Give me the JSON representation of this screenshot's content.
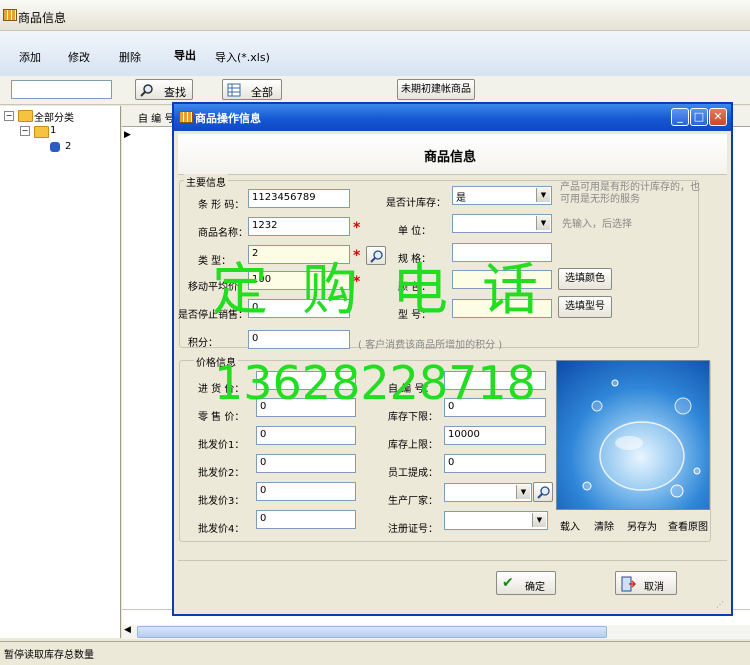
{
  "window": {
    "title": "商品信息"
  },
  "toolbar": {
    "add": "添加",
    "edit": "修改",
    "delete": "删除",
    "export": "导出",
    "import": "导入(*.xls)"
  },
  "search": {
    "value": "",
    "find": "查找",
    "all": "全部",
    "opening": "未期初建帐商品"
  },
  "tree": {
    "root": "全部分类",
    "child1": "1",
    "child2": "2"
  },
  "grid": {
    "col_code": "自 编 号"
  },
  "status": {
    "text": "暂停读取库存总数量"
  },
  "dialog": {
    "title": "商品操作信息",
    "heading": "商品信息",
    "main_group": "主要信息",
    "price_group": "价格信息",
    "fields": {
      "barcode_label": "条 形 码：",
      "barcode": "1123456789",
      "name_label": "商品名称：",
      "name": "1232",
      "category_label": "类     型：",
      "category": "2",
      "move_avg_label": "移动平均价",
      "move_avg": "100",
      "discontinued_label": "是否停止销售：",
      "discontinued": "0",
      "points_label": "积分：",
      "points": "0",
      "points_hint": "( 客户消费该商品所增加的积分 )",
      "stock_label": "是否计库存：",
      "stock": "是",
      "stock_hint": "产品可用是有形的计库存的，也可用是无形的服务",
      "unit_label": "单    位：",
      "unit": "",
      "unit_hint": "先输入，后选择",
      "spec_label": "规    格：",
      "spec": "",
      "color_label": "颜    色：",
      "color": "",
      "model_label": "型    号：",
      "model": "",
      "pick_color": "选填颜色",
      "pick_model": "选填型号",
      "cost_label": "进 货 价：",
      "cost": "",
      "retail_label": "零 售 价：",
      "retail": "0",
      "wh1_label": "批发价1：",
      "wh1": "0",
      "wh2_label": "批发价2：",
      "wh2": "0",
      "wh3_label": "批发价3：",
      "wh3": "0",
      "wh4_label": "批发价4：",
      "wh4": "0",
      "selfcode_label": "自 编 号：",
      "selfcode": "",
      "stock_min_label": "库存下限：",
      "stock_min": "0",
      "stock_max_label": "库存上限：",
      "stock_max": "10000",
      "commission_label": "员工提成：",
      "commission": "0",
      "maker_label": "生产厂家：",
      "maker": "",
      "reg_label": "注册证号：",
      "reg": ""
    },
    "image_actions": {
      "load": "载入",
      "clear": "清除",
      "save_as": "另存为",
      "view": "查看原图"
    },
    "ok": "确定",
    "cancel": "取消"
  },
  "watermark": {
    "line1": "定购电话",
    "line2": "13628228718"
  },
  "colors": {
    "title_blue": "#1557d4",
    "required": "#e00000",
    "watermark": "#22dd22",
    "input_yellow": "#fdfde6"
  },
  "icons": [
    "search-icon",
    "grid-icon",
    "folder-icon",
    "puzzle-icon",
    "zoom-icon",
    "checkmark-icon",
    "exit-door-icon",
    "minimize-icon",
    "maximize-icon",
    "close-icon",
    "table-app-icon"
  ]
}
